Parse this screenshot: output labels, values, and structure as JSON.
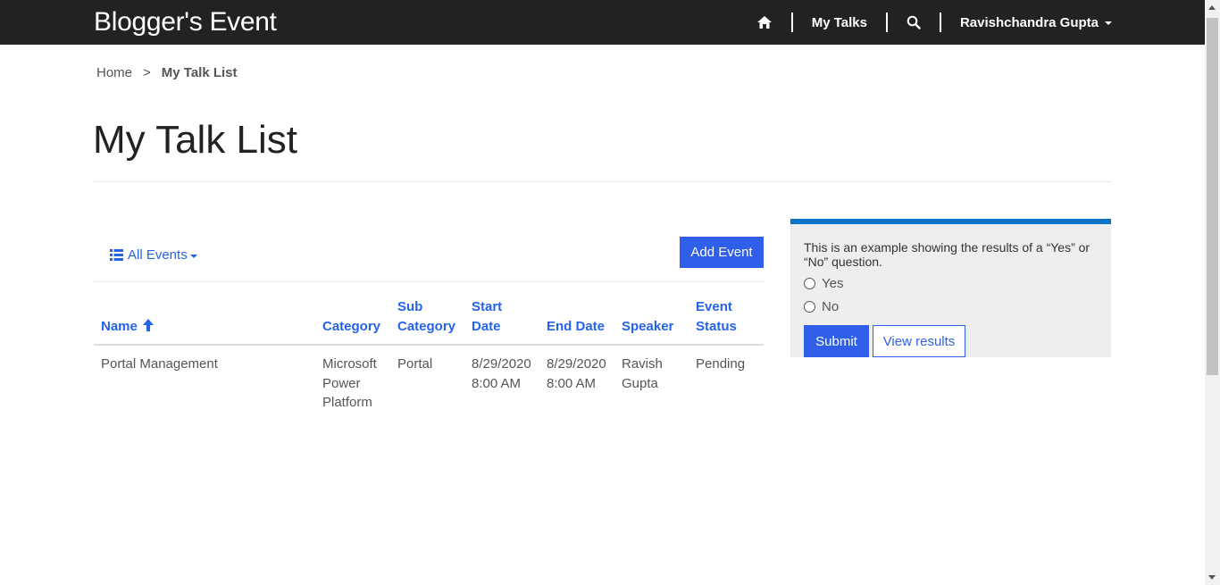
{
  "header": {
    "brand": "Blogger's Event",
    "nav": {
      "home_icon": "home-icon",
      "my_talks": "My Talks",
      "search_icon": "search-icon",
      "user": "Ravishchandra Gupta"
    }
  },
  "breadcrumb": {
    "home": "Home",
    "separator": ">",
    "current": "My Talk List"
  },
  "page_title": "My Talk List",
  "toolbar": {
    "filter_label": "All Events",
    "filter_icon": "list-icon",
    "add_button": "Add Event"
  },
  "table": {
    "headers": {
      "name": "Name",
      "category": "Category",
      "sub_category": [
        "Sub",
        "Category"
      ],
      "start_date": [
        "Start",
        "Date"
      ],
      "end_date": "End Date",
      "speaker": "Speaker",
      "event_status": [
        "Event",
        "Status"
      ]
    },
    "sort_icon": "arrow-up-icon",
    "rows": [
      {
        "name": "Portal Management",
        "category": [
          "Microsoft",
          "Power",
          "Platform"
        ],
        "sub_category": "Portal",
        "start_date": [
          "8/29/2020",
          "8:00 AM"
        ],
        "end_date": [
          "8/29/2020",
          "8:00 AM"
        ],
        "speaker": [
          "Ravish",
          "Gupta"
        ],
        "status": "Pending"
      }
    ]
  },
  "poll": {
    "question": "This is an example showing the results of a “Yes” or “No” question.",
    "options": [
      "Yes",
      "No"
    ],
    "submit": "Submit",
    "view_results": "View results"
  },
  "colors": {
    "nav_bg": "#222222",
    "accent": "#2f5fe8",
    "link": "#2563eb",
    "poll_border": "#0a73c8",
    "poll_bg": "#eeeeee"
  }
}
